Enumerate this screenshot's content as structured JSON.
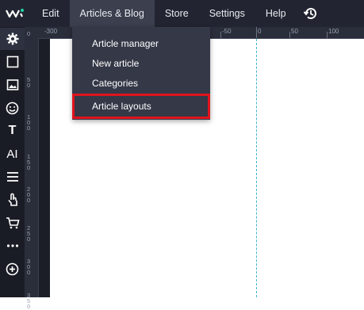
{
  "topbar": {
    "logo_icon": "wix-logo",
    "menu": [
      {
        "label": "Edit"
      },
      {
        "label": "Articles & Blog"
      },
      {
        "label": "Store"
      },
      {
        "label": "Settings"
      },
      {
        "label": "Help"
      }
    ],
    "history_icon": "history-icon"
  },
  "dropdown": {
    "items": [
      {
        "label": "Article manager"
      },
      {
        "label": "New article"
      },
      {
        "label": "Categories"
      },
      {
        "label": "Article layouts"
      }
    ]
  },
  "ruler_h": [
    "-300",
    "-50",
    "0",
    "50",
    "100"
  ],
  "ruler_v": [
    "0",
    "50",
    "100",
    "150",
    "200",
    "250",
    "300",
    "350"
  ],
  "tools": [
    "settings-icon",
    "box-icon",
    "image-icon",
    "emoji-icon",
    "text-icon",
    "ai-icon",
    "menu-icon",
    "touch-icon",
    "cart-icon",
    "more-icon",
    "add-icon"
  ],
  "tool_text": {
    "text": "T",
    "ai": "AI"
  },
  "colors": {
    "topbar": "#222531",
    "active_menu": "#3b3f4e",
    "dropdown": "#343847",
    "highlight": "#e0141e",
    "guide": "#3fb4d1"
  }
}
